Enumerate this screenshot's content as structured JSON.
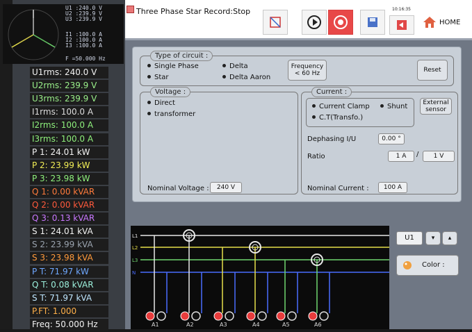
{
  "app": {
    "title": "Three Phase Star Record:Stop",
    "clock": "10:16:35",
    "home_label": "HOME"
  },
  "vector": {
    "u1": "U1 :240.0 V",
    "u2": "U2 :239.9 V",
    "u3": "U3 :239.9 V",
    "i1": "I1 :100.0 A",
    "i2": "I2 :100.0 A",
    "i3": "I3 :100.0 A",
    "freq": "F   =50.000 Hz"
  },
  "measurements": [
    {
      "text": "U1rms: 240.0 V",
      "color": "#f2f2f2"
    },
    {
      "text": "U2rms: 239.9 V",
      "color": "#9af08a"
    },
    {
      "text": "U3rms: 239.9 V",
      "color": "#9af08a"
    },
    {
      "text": "I1rms: 100.0 A",
      "color": "#dcdcdc"
    },
    {
      "text": "I2rms: 100.0 A",
      "color": "#8ef07c"
    },
    {
      "text": "I3rms: 100.0 A",
      "color": "#8ef07c"
    },
    {
      "text": "P 1: 24.01 kW",
      "color": "#f2f2f2"
    },
    {
      "text": "P 2: 23.99 kW",
      "color": "#f2ee56"
    },
    {
      "text": "P 3: 23.98 kW",
      "color": "#8ef07c"
    },
    {
      "text": "Q 1: 0.00 kVAR",
      "color": "#ff7b3c"
    },
    {
      "text": "Q 2: 0.00 kVAR",
      "color": "#ff5a3c"
    },
    {
      "text": "Q 3: 0.13 kVAR",
      "color": "#c878ff"
    },
    {
      "text": "S 1: 24.01 kVA",
      "color": "#f2f2f2"
    },
    {
      "text": "S 2: 23.99 kVA",
      "color": "#9aa3ae"
    },
    {
      "text": "S 3: 23.98 kVA",
      "color": "#ff9a3c"
    },
    {
      "text": "P T: 71.97 kW",
      "color": "#6fa8ff"
    },
    {
      "text": "Q T: 0.08 kVAR",
      "color": "#9cf0dc"
    },
    {
      "text": "S T: 71.97 kVA",
      "color": "#bfe6ff"
    },
    {
      "text": "P.FT: 1.000",
      "color": "#ffb04a"
    },
    {
      "text": "Freq: 50.000 Hz",
      "color": "#f2f2f2"
    }
  ],
  "circuit": {
    "legend": "Type of circuit :",
    "single_phase": "Single Phase",
    "star": "Star",
    "delta": "Delta",
    "delta_aaron": "Delta Aaron",
    "frequency_btn": "Frequency\n< 60 Hz",
    "reset_btn": "Reset"
  },
  "voltage": {
    "legend": "Voltage :",
    "direct": "Direct",
    "transformer": "transformer",
    "nominal_label": "Nominal Voltage :",
    "nominal_value": "240 V"
  },
  "current": {
    "legend": "Current       :",
    "clamp": "Current Clamp",
    "shunt": "Shunt",
    "ct": "C.T(Transfo.)",
    "external_btn": "External\nsensor",
    "dephasing_label": "Dephasing I/U",
    "dephasing_value": "0.00 °",
    "ratio_label": "Ratio",
    "ratio_primary": "1 A",
    "ratio_sep": "/",
    "ratio_secondary": "1 V",
    "nominal_label": "Nominal Current :",
    "nominal_value": "100 A"
  },
  "diagram": {
    "lines": [
      "L1",
      "L2",
      "L3",
      "N"
    ],
    "terminals": [
      "A1",
      "A2",
      "A3",
      "A4",
      "A5",
      "A6"
    ],
    "colors": {
      "L1": "#e8e8e8",
      "L2": "#e6e04a",
      "L3": "#6fd66f",
      "N": "#4a6cff"
    }
  },
  "side": {
    "channel_value": "U1",
    "down": "▾",
    "up": "▴",
    "color_label": "Color :"
  }
}
